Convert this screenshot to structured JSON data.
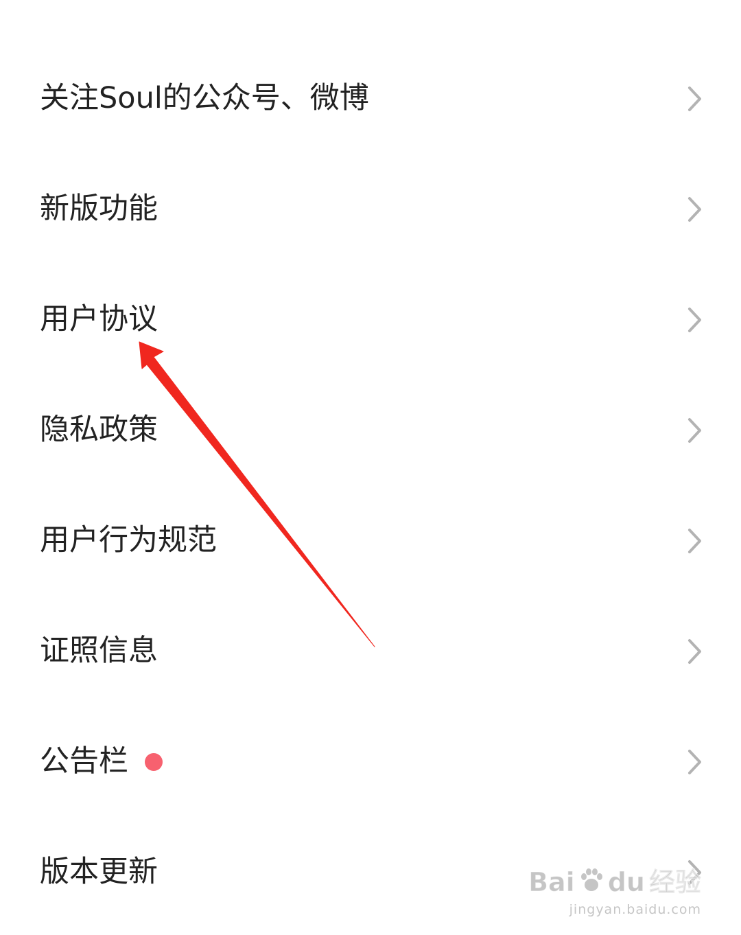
{
  "menu": {
    "items": [
      {
        "label": "关注Soul的公众号、微博"
      },
      {
        "label": "新版功能"
      },
      {
        "label": "用户协议"
      },
      {
        "label": "隐私政策"
      },
      {
        "label": "用户行为规范"
      },
      {
        "label": "证照信息"
      },
      {
        "label": "公告栏",
        "badge": "unread-dot"
      },
      {
        "label": "版本更新"
      }
    ]
  },
  "colors": {
    "text": "#222222",
    "chevron": "#b3b3b3",
    "badge": "#f7616f",
    "annotation_arrow": "#f0271f"
  },
  "watermark": {
    "brand_left": "Bai",
    "brand_paw": "paw-icon",
    "brand_du": "du",
    "brand_right": "经验",
    "url": "jingyan.baidu.com"
  }
}
